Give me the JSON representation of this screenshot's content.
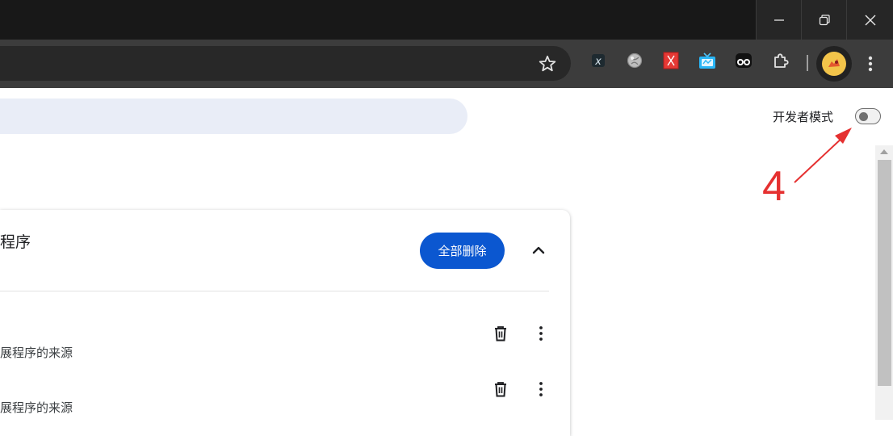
{
  "window": {
    "controls": [
      "minimize-icon",
      "restore-icon",
      "close-icon"
    ]
  },
  "toolbar": {
    "extensions": [
      "x-extension-icon",
      "globe-extension-icon",
      "red-x-extension-icon",
      "tv-extension-icon",
      "owl-extension-icon",
      "puzzle-icon"
    ],
    "bookmark_icon": "star-icon",
    "menu_icon": "more-vert-icon"
  },
  "header": {
    "developer_mode_label": "开发者模式",
    "developer_mode_on": false
  },
  "annotation": {
    "label": "4",
    "color": "#e53030"
  },
  "card": {
    "title": "程序",
    "remove_all_label": "全部删除",
    "items": [
      {
        "source_text": "展程序的来源"
      },
      {
        "source_text": "展程序的来源"
      }
    ]
  },
  "colors": {
    "accent": "#0b57d0",
    "search_bg": "#e9edf7",
    "titlebar": "#181818",
    "toolbar": "#3c3c3c"
  }
}
